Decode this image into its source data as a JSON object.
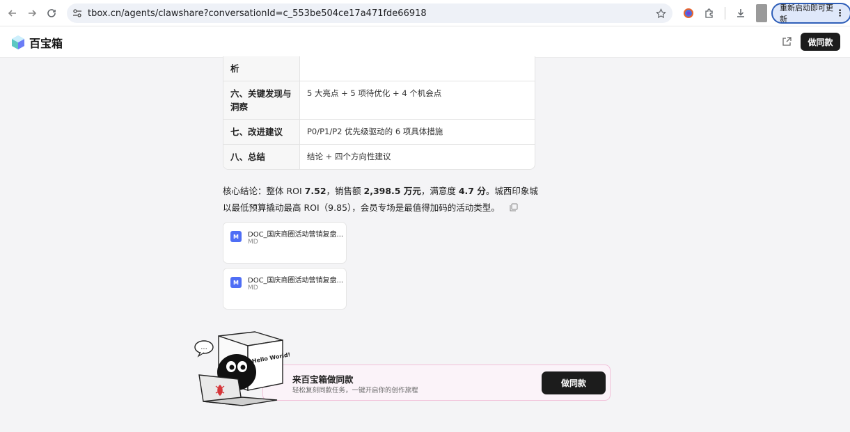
{
  "browser": {
    "url": "tbox.cn/agents/clawshare?conversationId=c_553be504ce17a471fde66918",
    "update_label": "重新启动即可更新"
  },
  "header": {
    "logo_text": "百宝箱",
    "do_same_label": "做同款"
  },
  "table": {
    "rows": [
      {
        "section": "析",
        "content": ""
      },
      {
        "section": "六、关键发现与洞察",
        "content": "5 大亮点 + 5 项待优化 + 4 个机会点"
      },
      {
        "section": "七、改进建议",
        "content": "P0/P1/P2 优先级驱动的 6 项具体措施"
      },
      {
        "section": "八、总结",
        "content": "结论 + 四个方向性建议"
      }
    ]
  },
  "summary": {
    "p1": "核心结论：整体 ROI ",
    "roi": "7.52",
    "p2": "，销售额 ",
    "sales": "2,398.5 万元",
    "p3": "，满意度 ",
    "satisfaction": "4.7 分",
    "p4": "。城西印象城以最低预算撬动最高 ROI（9.85），会员专场是最值得加码的活动类型。"
  },
  "files": [
    {
      "name": "DOC_国庆商圈活动营销复盘...",
      "type": "MD",
      "icon": "M"
    },
    {
      "name": "DOC_国庆商圈活动营销复盘...",
      "type": "MD",
      "icon": "M"
    }
  ],
  "promo": {
    "title": "来百宝箱做同款",
    "subtitle": "轻松复刻同款任务，一键开启你的创作旅程",
    "button": "做同款",
    "mascot_sign": "Hello World!",
    "bubble": "..."
  },
  "colors": {
    "accent_dark": "#1c1c1c",
    "file_icon": "#4f6ef5",
    "promo_border": "#f2bfd9"
  }
}
